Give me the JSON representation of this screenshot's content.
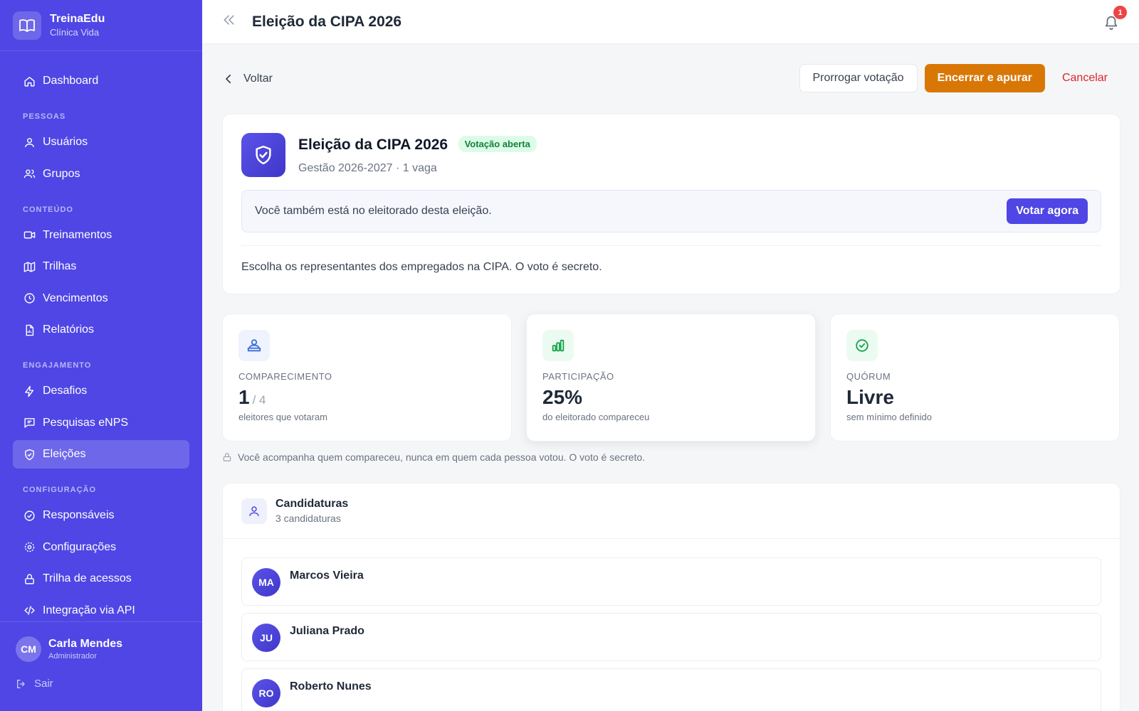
{
  "brand": {
    "name": "TreinaEdu",
    "org": "Clínica Vida"
  },
  "nav": {
    "dashboard": "Dashboard",
    "section_pessoas": "PESSOAS",
    "usuarios": "Usuários",
    "grupos": "Grupos",
    "section_conteudo": "CONTEÚDO",
    "treinamentos": "Treinamentos",
    "trilhas": "Trilhas",
    "vencimentos": "Vencimentos",
    "relatorios": "Relatórios",
    "section_engajamento": "ENGAJAMENTO",
    "desafios": "Desafios",
    "pesquisas": "Pesquisas eNPS",
    "eleicoes": "Eleições",
    "section_configuracao": "CONFIGURAÇÃO",
    "responsaveis": "Responsáveis",
    "configuracoes": "Configurações",
    "trilha_acessos": "Trilha de acessos",
    "integracao": "Integração via API"
  },
  "user": {
    "initials": "CM",
    "name": "Carla Mendes",
    "role": "Administrador",
    "logout": "Sair"
  },
  "topbar": {
    "title": "Eleição da CIPA 2026",
    "notifications": "1"
  },
  "actions": {
    "back": "Voltar",
    "extend": "Prorrogar votação",
    "close": "Encerrar e apurar",
    "cancel": "Cancelar"
  },
  "election": {
    "title": "Eleição da CIPA 2026",
    "status": "Votação aberta",
    "subtitle": "Gestão 2026-2027 · 1 vaga",
    "voter_notice": "Você também está no eleitorado desta eleição.",
    "vote_button": "Votar agora",
    "description": "Escolha os representantes dos empregados na CIPA. O voto é secreto."
  },
  "stats": {
    "attendance": {
      "label": "COMPARECIMENTO",
      "value": "1",
      "of": "/ 4",
      "caption": "eleitores que votaram"
    },
    "participation": {
      "label": "PARTICIPAÇÃO",
      "value": "25%",
      "caption": "do eleitorado compareceu"
    },
    "quorum": {
      "label": "QUÓRUM",
      "value": "Livre",
      "caption": "sem mínimo definido"
    }
  },
  "privacy_note": "Você acompanha quem compareceu, nunca em quem cada pessoa votou. O voto é secreto.",
  "candidates": {
    "title": "Candidaturas",
    "count": "3 candidaturas",
    "items": [
      {
        "initials": "MA",
        "name": "Marcos Vieira"
      },
      {
        "initials": "JU",
        "name": "Juliana Prado"
      },
      {
        "initials": "RO",
        "name": "Roberto Nunes"
      }
    ]
  },
  "colors": {
    "sidebar": "#4f46e5",
    "primary_action": "#d97706",
    "danger": "#dc2626",
    "success_badge": "#15803d"
  }
}
